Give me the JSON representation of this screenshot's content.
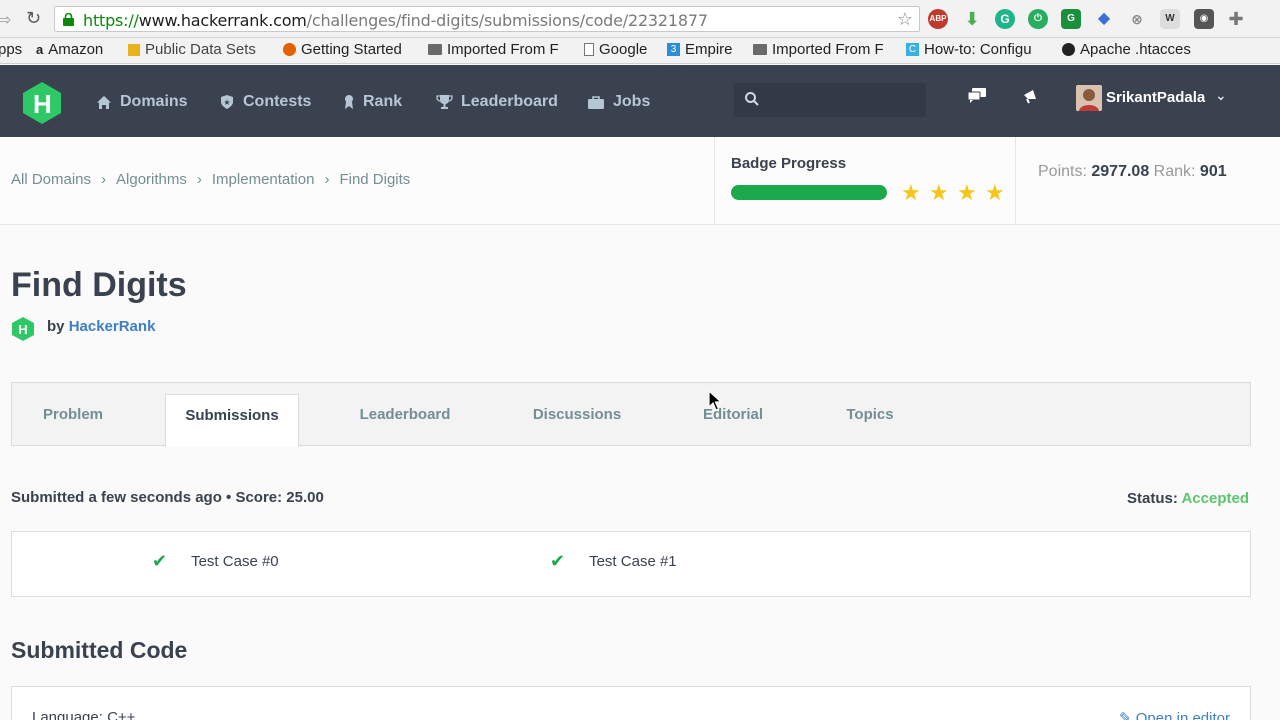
{
  "browser": {
    "url_protocol": "https://",
    "url_host": "www.hackerrank.com",
    "url_path": "/challenges/find-digits/submissions/code/22321877",
    "bookmarks": [
      {
        "label": "pps"
      },
      {
        "label": "Amazon"
      },
      {
        "label": "Public Data Sets"
      },
      {
        "label": "Getting Started"
      },
      {
        "label": "Imported From F"
      },
      {
        "label": "Google"
      },
      {
        "label": "Empire"
      },
      {
        "label": "Imported From F"
      },
      {
        "label": "How-to: Configu"
      },
      {
        "label": "Apache .htacces"
      }
    ]
  },
  "header": {
    "logo_letter": "H",
    "nav": [
      {
        "label": "Domains",
        "icon": "home-icon"
      },
      {
        "label": "Contests",
        "icon": "trophy-shield-icon"
      },
      {
        "label": "Rank",
        "icon": "rank-icon"
      },
      {
        "label": "Leaderboard",
        "icon": "trophy-icon"
      },
      {
        "label": "Jobs",
        "icon": "briefcase-icon"
      }
    ],
    "search_placeholder": "",
    "username": "SrikantPadala"
  },
  "breadcrumb": [
    "All Domains",
    "Algorithms",
    "Implementation",
    "Find Digits"
  ],
  "badge": {
    "title": "Badge Progress",
    "progress": 1.0,
    "stars": 4
  },
  "stats": {
    "points_label": "Points:",
    "points_value": "2977.08",
    "rank_label": "Rank:",
    "rank_value": "901"
  },
  "challenge": {
    "title": "Find Digits",
    "by_label": "by",
    "author": "HackerRank"
  },
  "tabs": [
    "Problem",
    "Submissions",
    "Leaderboard",
    "Discussions",
    "Editorial",
    "Topics"
  ],
  "active_tab": "Submissions",
  "submission": {
    "summary": "Submitted a few seconds ago • Score: 25.00",
    "status_label": "Status:",
    "status_value": "Accepted",
    "test_cases": [
      "Test Case #0",
      "Test Case #1"
    ]
  },
  "code": {
    "title": "Submitted Code",
    "language": "Language: C++",
    "open_editor": "Open in editor"
  },
  "colors": {
    "header_bg": "#39424e",
    "accent_green": "#1ba94c",
    "link_blue": "#3d7fc6",
    "star_gold": "#f5c518"
  }
}
